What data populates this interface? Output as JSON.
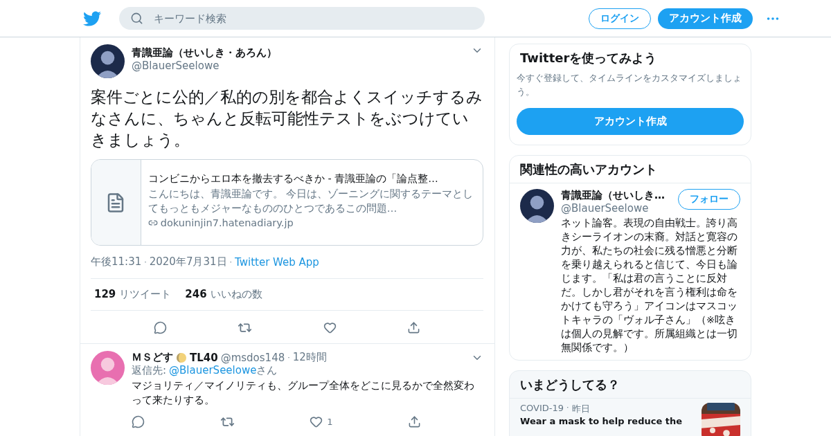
{
  "header": {
    "search": {
      "placeholder": "キーワード検索"
    },
    "login_button": "ログイン",
    "signup_button": "アカウント作成"
  },
  "tweet": {
    "name": "青識亜論（せいしき・あろん）",
    "handle": "@BlauerSeelowe",
    "text": "案件ごとに公的／私的の別を都合よくスイッチするみなさんに、ちゃんと反転可能性テストをぶつけていきましょう。",
    "card": {
      "title": "コンビニからエロ本を撤去するべきか - 青識亜論の「論点整…",
      "description": "こんにちは、青識亜論です。 今日は、ゾーニングに関するテーマとしてもっともメジャーなもののひとつであるこの問題…",
      "domain": "dokuninjin7.hatenadiary.jp"
    },
    "time": "午後11:31",
    "separator": "·",
    "date": "2020年7月31日",
    "source": "Twitter Web App",
    "stats": [
      {
        "count": "129",
        "label": "リツイート"
      },
      {
        "count": "246",
        "label": "いいねの数"
      }
    ],
    "actions": [
      {
        "kind": "reply"
      },
      {
        "kind": "retweet"
      },
      {
        "kind": "like"
      },
      {
        "kind": "share"
      }
    ]
  },
  "reply": {
    "name": "ＭＳどす",
    "name_suffix": "TL40",
    "handle": "@msdos148",
    "separator": "·",
    "time": "12時間",
    "reply_label": "返信先:",
    "reply_handle": "@BlauerSeelowe",
    "reply_suffix": "さん",
    "text": "マジョリティ／マイノリティも、グループ全体をどこに見るかで全然変わって来たりする。",
    "actions": [
      {
        "kind": "reply"
      },
      {
        "kind": "retweet"
      },
      {
        "kind": "like",
        "count": "1"
      },
      {
        "kind": "share"
      }
    ]
  },
  "sidebar": {
    "signup_card": {
      "title": "Twitterを使ってみよう",
      "text": "今すぐ登録して、タイムラインをカスタマイズしましょう。",
      "button": "アカウント作成"
    },
    "related": {
      "title": "関連性の高いアカウント",
      "accounts": [
        {
          "name": "青識亜論（せいしき…",
          "handle": "@BlauerSeelowe",
          "button": "フォロー",
          "bio": "ネット論客。表現の自由戦士。誇り高きシーライオンの末裔。対話と寛容の力が、私たちの社会に残る憎悪と分断を乗り越えられると信じて、今日も論じます。「私は君の言うことに反対だ。しかし君がそれを言う権利は命をかけても守ろう」アイコンはマスコットキャラの「ヴォル子さん」（※呟きは個人の見解です。所属組織とは一切無関係です。）"
        }
      ]
    },
    "trends": {
      "title": "いまどうしてる？",
      "items": [
        {
          "category": "COVID-19",
          "separator": "·",
          "time": "昨日",
          "headline": "Wear a mask to help reduce the",
          "kind": "picture"
        }
      ]
    }
  }
}
